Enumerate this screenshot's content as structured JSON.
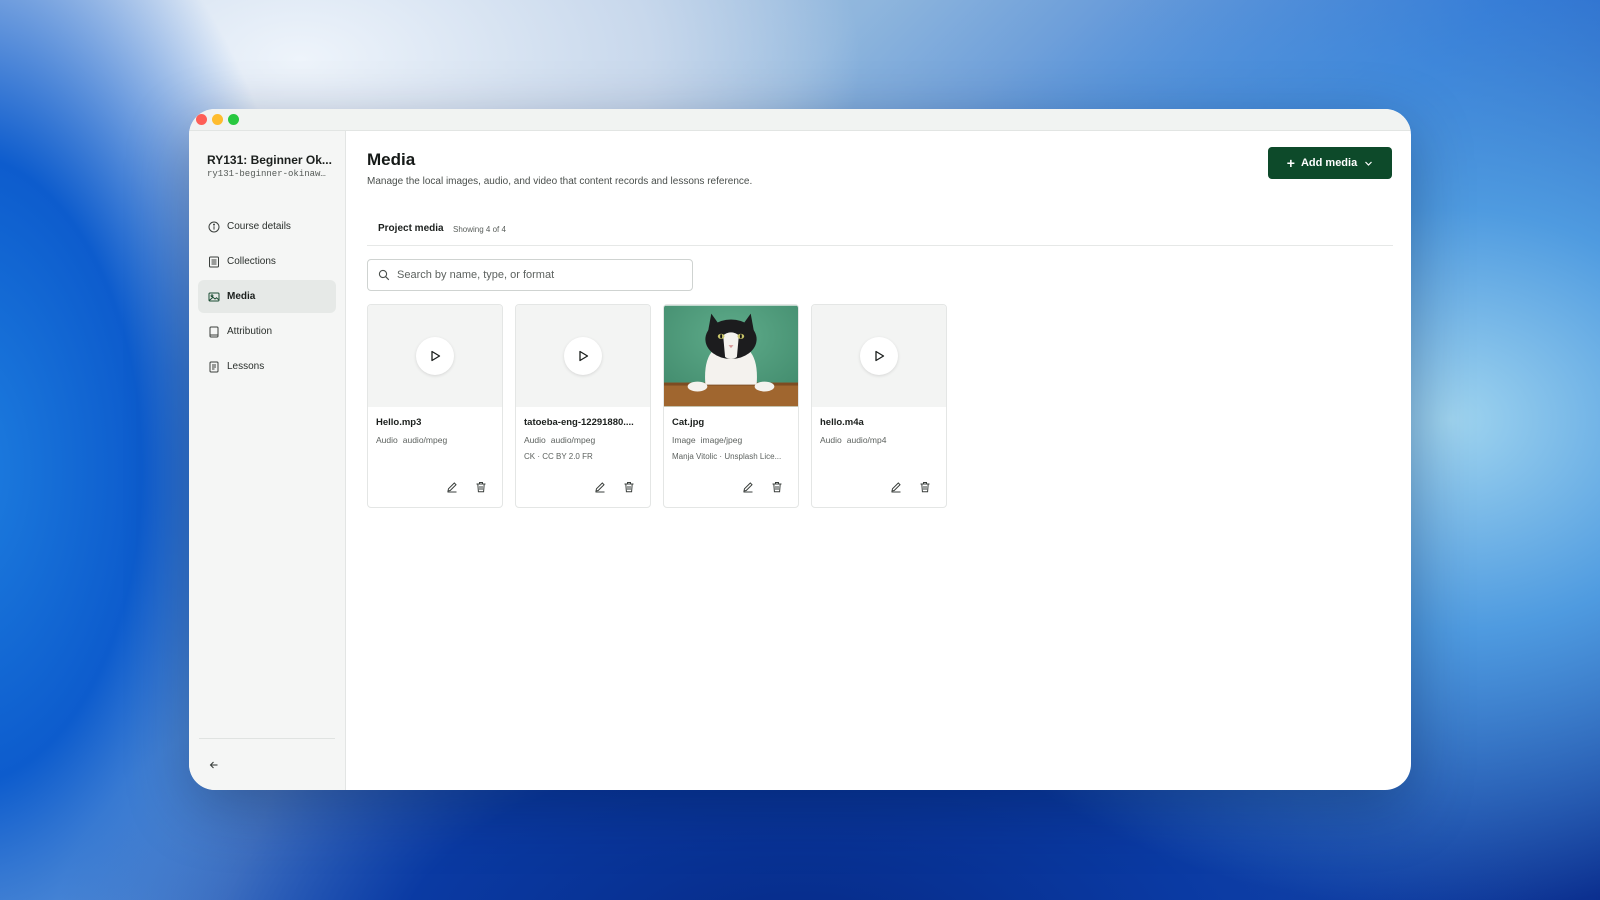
{
  "sidebar": {
    "course_title": "RY131: Beginner Ok...",
    "course_slug": "ry131-beginner-okinaw…",
    "items": [
      {
        "label": "Course details",
        "icon": "info-icon"
      },
      {
        "label": "Collections",
        "icon": "list-icon"
      },
      {
        "label": "Media",
        "icon": "image-icon",
        "active": true
      },
      {
        "label": "Attribution",
        "icon": "book-icon"
      },
      {
        "label": "Lessons",
        "icon": "document-icon"
      }
    ]
  },
  "main": {
    "title": "Media",
    "description": "Manage the local images, audio, and video that content records and lessons reference.",
    "add_button_label": "Add media",
    "tab_label": "Project media",
    "tab_count": "Showing 4 of 4",
    "search_placeholder": "Search by name, type, or format"
  },
  "media": [
    {
      "name": "Hello.mp3",
      "kind": "Audio",
      "mime": "audio/mpeg",
      "attribution": "",
      "thumbnail": "play-icon"
    },
    {
      "name": "tatoeba-eng-12291880....",
      "kind": "Audio",
      "mime": "audio/mpeg",
      "attribution": "CK · CC BY 2.0 FR",
      "thumbnail": "play-icon"
    },
    {
      "name": "Cat.jpg",
      "kind": "Image",
      "mime": "image/jpeg",
      "attribution": "Manja Vitolic · Unsplash Lice...",
      "thumbnail": "cat-image"
    },
    {
      "name": "hello.m4a",
      "kind": "Audio",
      "mime": "audio/mp4",
      "attribution": "",
      "thumbnail": "play-icon"
    }
  ],
  "colors": {
    "accent": "#0d4a2a",
    "sidebar_bg": "#f5f6f5",
    "active_nav_bg": "#e6e9e7"
  }
}
